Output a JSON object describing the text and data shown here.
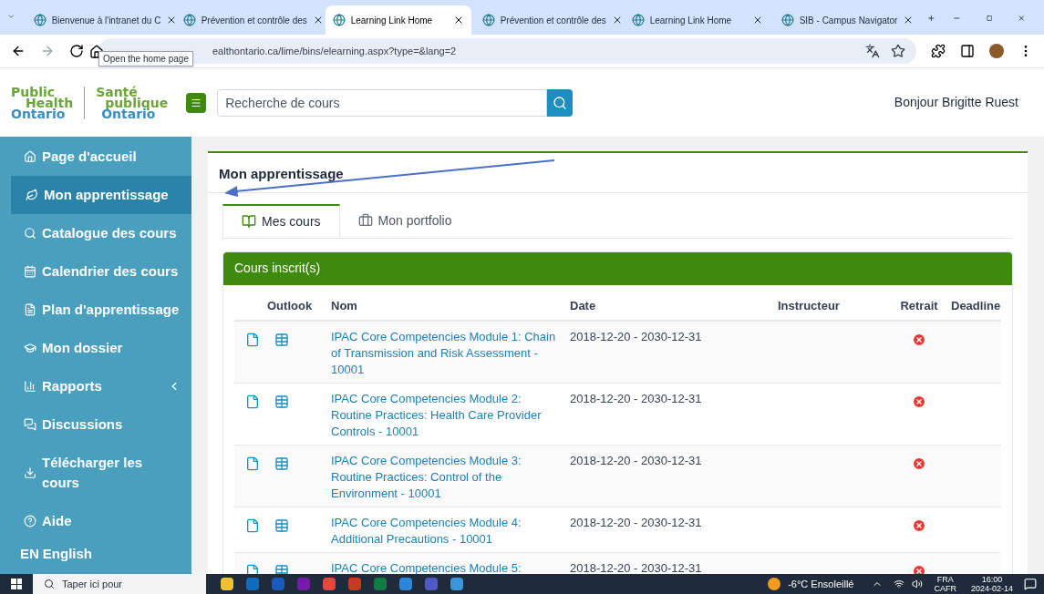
{
  "browser": {
    "tabs": [
      {
        "title": "Bienvenue à l'intranet du C",
        "selected": false
      },
      {
        "title": "Prévention et contrôle des",
        "selected": false
      },
      {
        "title": "Learning Link Home",
        "selected": true
      },
      {
        "title": "Prévention et contrôle des",
        "selected": false
      },
      {
        "title": "Learning Link Home",
        "selected": false
      },
      {
        "title": "SIB - Campus Navigator",
        "selected": false
      }
    ],
    "url": "ealthontario.ca/lime/bins/elearning.aspx?type=&lang=2",
    "tooltip": "Open the home page"
  },
  "header": {
    "logo_en": [
      "Public",
      "Health",
      "Ontario"
    ],
    "logo_fr": [
      "Santé",
      "publique",
      "Ontario"
    ],
    "search_placeholder": "Recherche de cours",
    "greeting": "Bonjour Brigitte Ruest"
  },
  "sidebar": {
    "items": [
      {
        "label": "Page d'accueil",
        "selected": false,
        "kind": "link"
      },
      {
        "label": "Mon apprentissage",
        "selected": true,
        "kind": "link"
      },
      {
        "label": "Catalogue des cours",
        "selected": false,
        "kind": "link"
      },
      {
        "label": "Calendrier des cours",
        "selected": false,
        "kind": "link"
      },
      {
        "label": "Plan d'apprentissage",
        "selected": false,
        "kind": "link"
      },
      {
        "label": "Mon dossier",
        "selected": false,
        "kind": "link"
      },
      {
        "label": "Rapports",
        "selected": false,
        "kind": "submenu"
      },
      {
        "label": "Discussions",
        "selected": false,
        "kind": "link"
      },
      {
        "label": "Télécharger les cours",
        "selected": false,
        "kind": "link"
      },
      {
        "label": "Aide",
        "selected": false,
        "kind": "link"
      }
    ],
    "language": {
      "code": "EN",
      "label": "English"
    }
  },
  "main": {
    "title": "Mon apprentissage",
    "tabs": [
      {
        "label": "Mes cours",
        "selected": true
      },
      {
        "label": "Mon portfolio",
        "selected": false
      }
    ],
    "panel_title": "Cours inscrit(s)",
    "columns": [
      "Outlook",
      "Nom",
      "Date",
      "Instructeur",
      "Retrait",
      "Deadline"
    ],
    "rows": [
      {
        "name": "IPAC Core Competencies Module 1: Chain of Transmission and Risk Assessment - 10001",
        "date": "2018-12-20 - 2030-12-31"
      },
      {
        "name": "IPAC Core Competencies Module 2: Routine Practices: Health Care Provider Controls - 10001",
        "date": "2018-12-20 - 2030-12-31"
      },
      {
        "name": "IPAC Core Competencies Module 3: Routine Practices: Control of the Environment - 10001",
        "date": "2018-12-20 - 2030-12-31"
      },
      {
        "name": "IPAC Core Competencies Module 4: Additional Precautions - 10001",
        "date": "2018-12-20 - 2030-12-31"
      },
      {
        "name": "IPAC Core Competencies Module 5:",
        "date": "2018-12-20 - 2030-12-31"
      }
    ]
  },
  "taskbar": {
    "search_placeholder": "Taper ici pour",
    "weather": "-6°C Ensoleillé",
    "lang": [
      "FRA",
      "CAFR"
    ],
    "time": "16:00",
    "date": "2024-02-14"
  }
}
